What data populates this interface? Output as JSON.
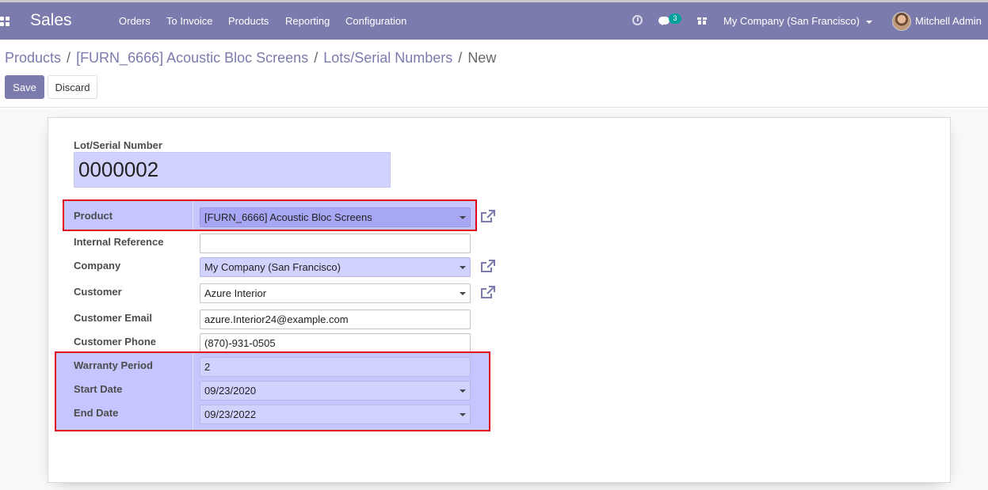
{
  "navbar": {
    "brand": "Sales",
    "menu": [
      "Orders",
      "To Invoice",
      "Products",
      "Reporting",
      "Configuration"
    ],
    "chat_count": "3",
    "company": "My Company (San Francisco)",
    "user": "Mitchell Admin"
  },
  "breadcrumb": {
    "items": [
      "Products",
      "[FURN_6666] Acoustic Bloc Screens",
      "Lots/Serial Numbers"
    ],
    "current": "New"
  },
  "buttons": {
    "save": "Save",
    "discard": "Discard"
  },
  "form": {
    "lot_label": "Lot/Serial Number",
    "lot_value": "0000002",
    "product_label": "Product",
    "product_value": "[FURN_6666] Acoustic Bloc Screens",
    "internal_ref_label": "Internal Reference",
    "internal_ref_value": "",
    "company_label": "Company",
    "company_value": "My Company (San Francisco)",
    "customer_label": "Customer",
    "customer_value": "Azure Interior",
    "customer_email_label": "Customer Email",
    "customer_email_value": "azure.Interior24@example.com",
    "customer_phone_label": "Customer Phone",
    "customer_phone_value": "(870)-931-0505",
    "warranty_label": "Warranty Period",
    "warranty_value": "2",
    "start_label": "Start Date",
    "start_value": "09/23/2020",
    "end_label": "End Date",
    "end_value": "09/23/2022"
  },
  "colors": {
    "brand": "#7c7bad",
    "highlight_border": "#e0001b",
    "highlight_fill": "#c5c5ff",
    "required_field": "#d2d2ff",
    "chat_badge": "#00a09d"
  }
}
